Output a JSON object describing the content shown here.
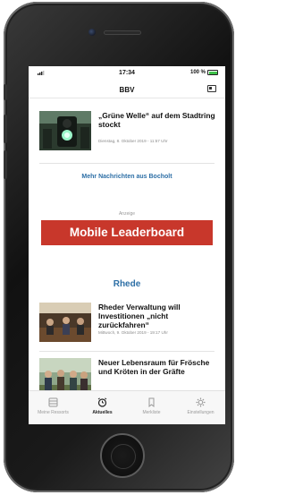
{
  "status_bar": {
    "time": "17:34",
    "battery": "100 %"
  },
  "header": {
    "title": "BBV",
    "icon": "newspaper-icon"
  },
  "articles_top": [
    {
      "title": "„Grüne Welle“ auf dem Stadtring stockt",
      "date": "Dienstag, 8. Oktober 2019 - 11:57 Uhr"
    }
  ],
  "more_link": "Mehr Nachrichten aus Bocholt",
  "ad": {
    "label": "Anzeige",
    "banner": "Mobile Leaderboard",
    "color": "#c8372b"
  },
  "section": {
    "title": "Rhede",
    "color": "#2d6fa6"
  },
  "articles_rhede": [
    {
      "title": "Rheder Verwaltung will Investitionen „nicht zurückfahren“",
      "date": "Mittwoch, 9. Oktober 2019 - 19:17 Uhr"
    },
    {
      "title": "Neuer Lebensraum für Frösche und Kröten in der Gräfte",
      "date": ""
    }
  ],
  "tabbar": [
    {
      "label": "Meine Ressorts",
      "icon": "grid-icon",
      "active": false
    },
    {
      "label": "Aktuelles",
      "icon": "alarm-clock-icon",
      "active": true
    },
    {
      "label": "Merkliste",
      "icon": "bookmark-icon",
      "active": false
    },
    {
      "label": "Einstellungen",
      "icon": "gear-icon",
      "active": false
    }
  ]
}
